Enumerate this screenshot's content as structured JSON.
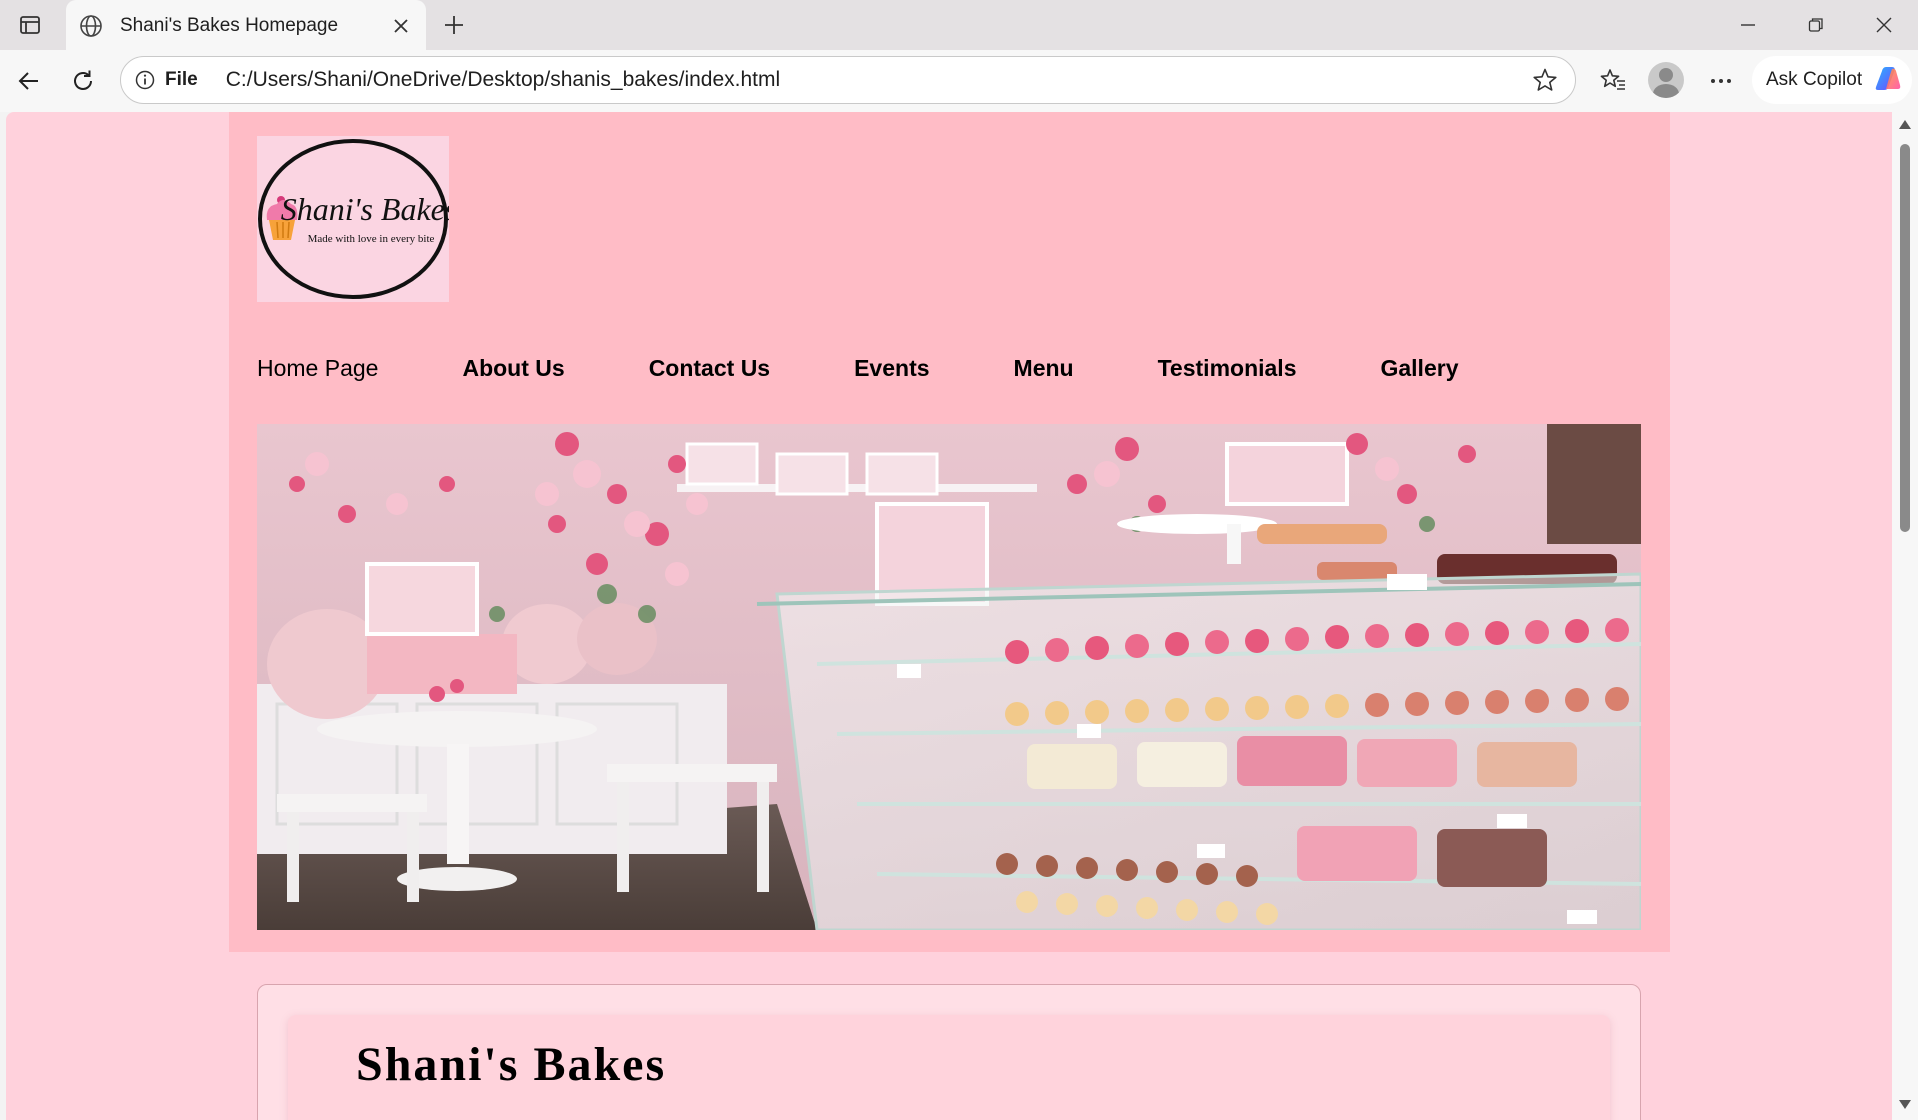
{
  "browser": {
    "tab_title": "Shani's Bakes Homepage",
    "address_scheme": "File",
    "address_url": "C:/Users/Shani/OneDrive/Desktop/shanis_bakes/index.html",
    "copilot_label": "Ask Copilot"
  },
  "site": {
    "logo": {
      "brand": "Shani's Bakes",
      "tagline": "Made with love in every bite"
    },
    "nav": [
      {
        "label": "Home Page"
      },
      {
        "label": "About Us"
      },
      {
        "label": "Contact Us"
      },
      {
        "label": "Events"
      },
      {
        "label": "Menu"
      },
      {
        "label": "Testimonials"
      },
      {
        "label": "Gallery"
      }
    ],
    "hero_alt": "bakery display with cupcakes and cakes",
    "card_title": "Shani's Bakes"
  },
  "colors": {
    "page_bg": "#ffd1dc",
    "header_bg": "#ffbcc6",
    "card_bg": "#ffdfe6"
  }
}
